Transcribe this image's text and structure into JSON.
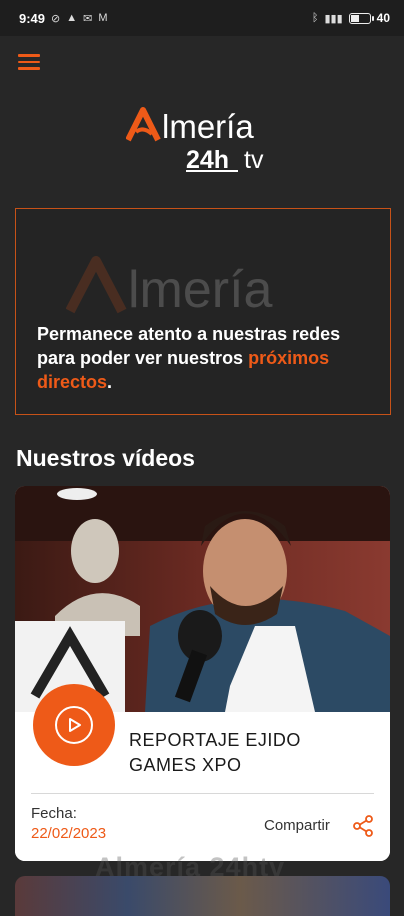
{
  "status_bar": {
    "time": "9:49",
    "battery": "40",
    "notification_icons": [
      "wifi-off-icon",
      "bell-icon",
      "message-icon",
      "gmail-icon"
    ],
    "system_icons": [
      "bluetooth-icon",
      "signal-icon",
      "battery-icon"
    ]
  },
  "app": {
    "logo_name": "Almería",
    "logo_sub": "24htv",
    "accent": "#ee5a18",
    "background": "#272727"
  },
  "live": {
    "message_before": "Permanece atento a nuestras redes para poder ver nuestros",
    "message_accent": "próximos directos",
    "message_after": "."
  },
  "videos": {
    "section_title": "Nuestros vídeos",
    "items": [
      {
        "title": "REPORTAJE EJIDO GAMES XPO",
        "date_label": "Fecha:",
        "date": "22/02/2023",
        "share_label": "Compartir"
      }
    ]
  },
  "footer_watermark": "Almería 24htv"
}
